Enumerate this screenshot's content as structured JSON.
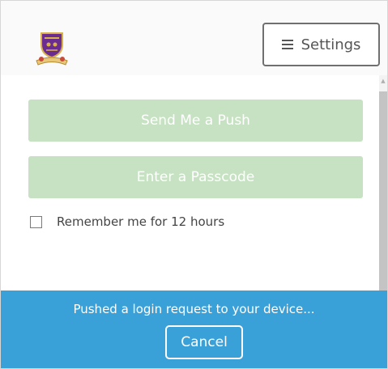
{
  "header": {
    "settings_label": "Settings",
    "settings_icon": "hamburger-icon",
    "logo_icon": "university-crest"
  },
  "auth": {
    "push_label": "Send Me a Push",
    "passcode_label": "Enter a Passcode",
    "remember_label": "Remember me for 12 hours",
    "remember_checked": false
  },
  "status": {
    "message": "Pushed a login request to your device...",
    "cancel_label": "Cancel"
  },
  "colors": {
    "button_disabled_green": "#c6e2c2",
    "status_blue": "#3aa0d8",
    "crest_purple": "#6b2c8f",
    "crest_gold": "#d9b14a"
  }
}
